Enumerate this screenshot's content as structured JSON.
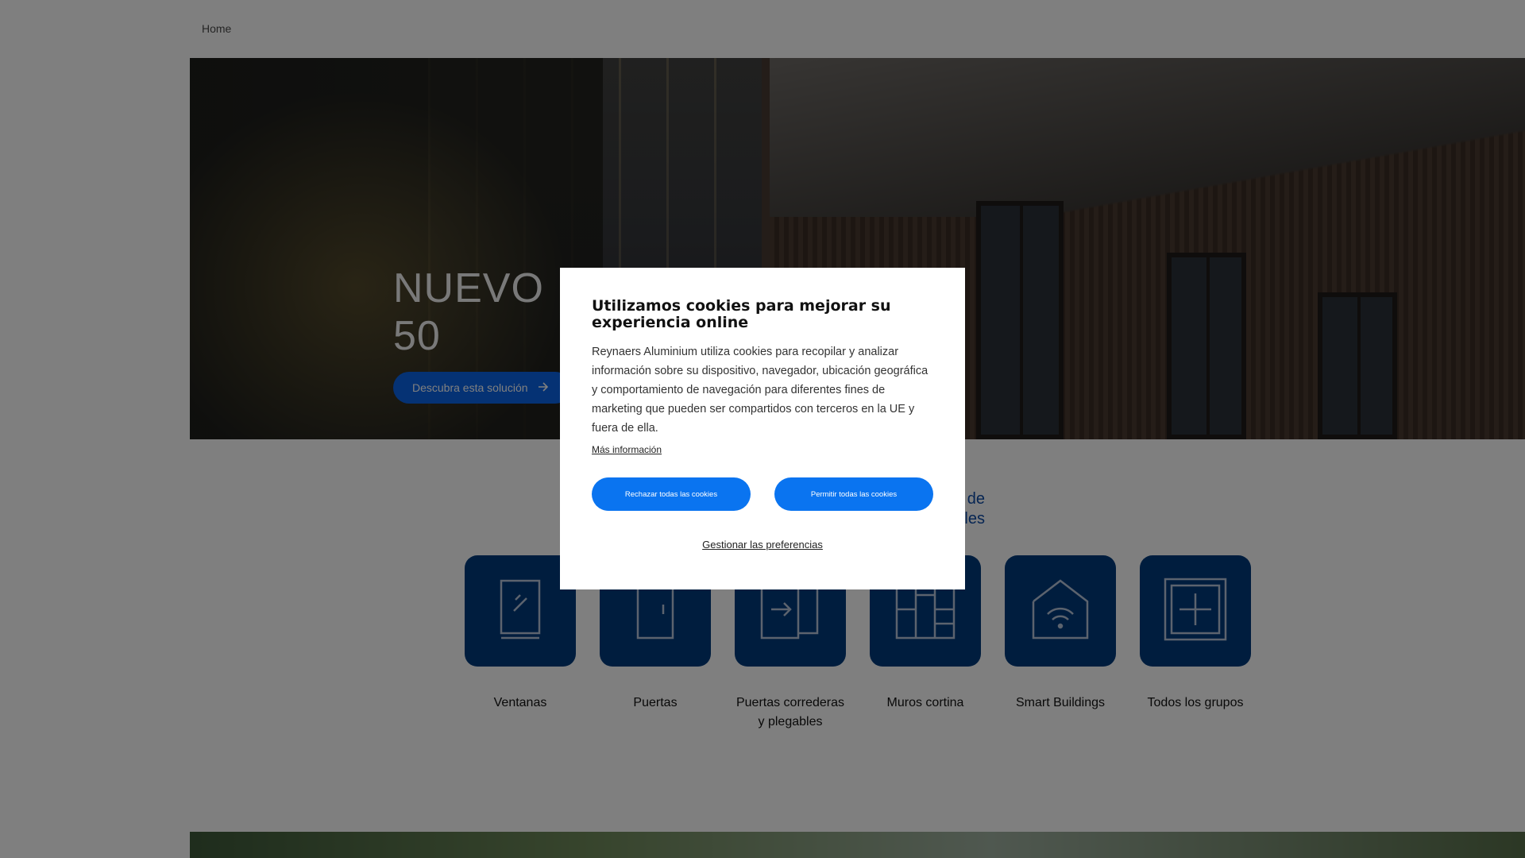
{
  "breadcrumb": {
    "home": "Home"
  },
  "hero": {
    "title_line1": "NUEVO |",
    "title_line2": "50",
    "cta_label": "Descubra esta solución",
    "cta_icon": "arrow-right-icon"
  },
  "products": {
    "title_line1": "de",
    "title_line2": "les",
    "tiles": [
      {
        "label": "Ventanas",
        "icon": "window-icon"
      },
      {
        "label": "Puertas",
        "icon": "door-icon"
      },
      {
        "label": "Puertas correderas y plegables",
        "icon": "sliding-door-icon"
      },
      {
        "label": "Muros cortina",
        "icon": "curtain-wall-icon"
      },
      {
        "label": "Smart Buildings",
        "icon": "smart-home-icon"
      },
      {
        "label": "Todos los grupos",
        "icon": "plus-square-icon"
      }
    ]
  },
  "cookie_modal": {
    "title": "Utilizamos cookies para mejorar su experiencia online",
    "body": "Reynaers Aluminium utiliza cookies para recopilar y analizar información sobre su dispositivo, navegador, ubicación geográfica y comportamiento de navegación para diferentes fines de marketing que pueden ser compartidos con terceros en la UE y fuera de ella.",
    "more_info": "Más información",
    "reject_all": "Rechazar todas las cookies",
    "allow_all": "Permitir todas las cookies",
    "manage_prefs": "Gestionar las preferencias"
  },
  "colors": {
    "accent_blue": "#0a74f0",
    "tile_navy": "#003b7c",
    "overlay": "rgba(0,0,0,0.5)"
  }
}
